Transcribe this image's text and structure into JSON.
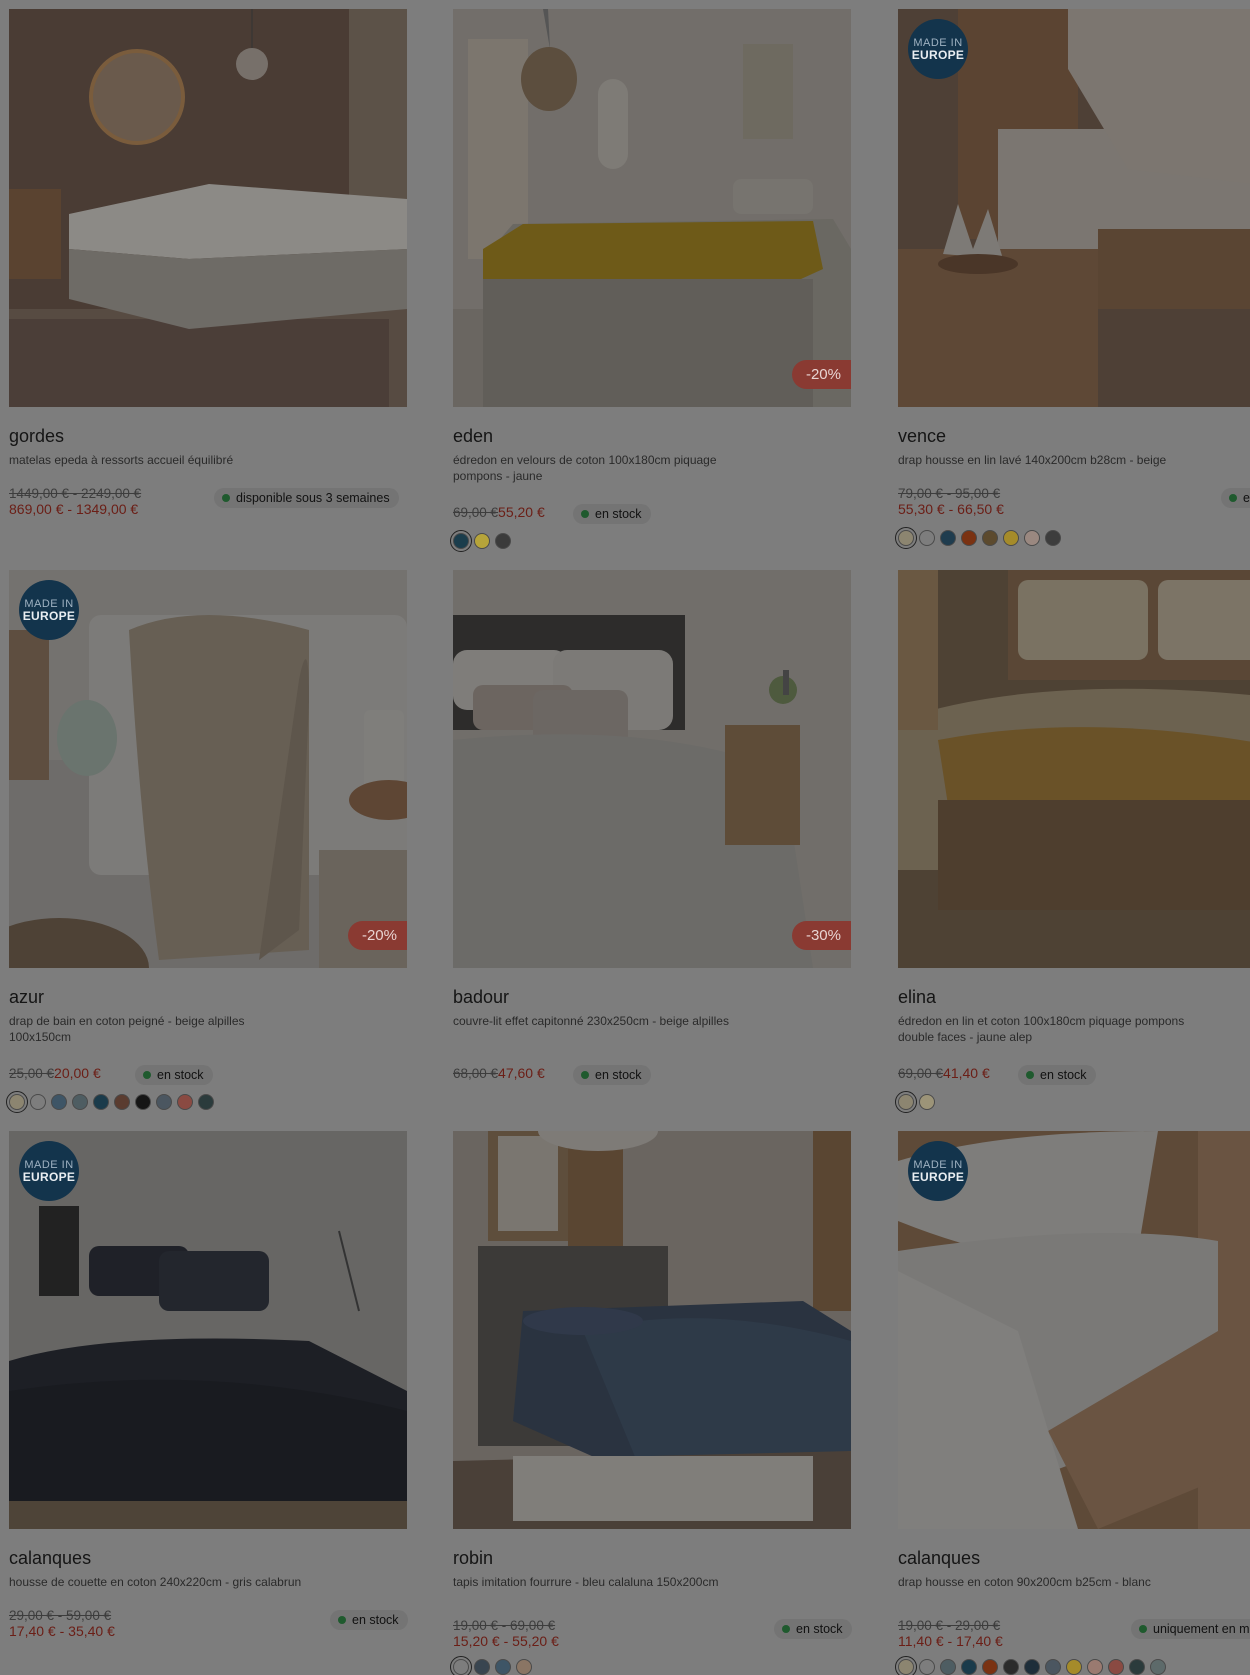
{
  "made_in_europe": {
    "line1": "MADE IN",
    "line2": "EUROPE"
  },
  "products": [
    {
      "name": "gordes",
      "desc": "matelas epeda à ressorts accueil équilibré",
      "old": "1449,00 € - 2249,00 €",
      "new": "869,00 € - 1349,00 €",
      "stock": "disponible sous 3 semaines",
      "discount": "",
      "eu": false,
      "swatches": []
    },
    {
      "name": "eden",
      "desc": "édredon en velours de coton 100x180cm piquage pompons - jaune",
      "old": "69,00 €",
      "new": "55,20 €",
      "stock": "en stock",
      "discount": "-20%",
      "eu": false,
      "swatches": [
        "#1b3d4c",
        "#b6a43a",
        "#3b3b3b"
      ]
    },
    {
      "name": "vence",
      "desc": "drap housse en lin lavé 140x200cm b28cm - beige",
      "old": "79,00 € - 95,00 €",
      "new": "55,30 € - 66,50 €",
      "stock": "en",
      "discount": "",
      "eu": true,
      "swatches": [
        "#8c8570",
        "#7d7d7d",
        "#1f3c4e",
        "#7a3212",
        "#5c4a2e",
        "#a58b2a",
        "#9a8880",
        "#3d3d3d"
      ]
    },
    {
      "name": "azur",
      "desc": "drap de bain en coton peigné - beige alpilles 100x150cm",
      "old": "25,00 €",
      "new": "20,00 €",
      "stock": "en stock",
      "discount": "-20%",
      "eu": true,
      "swatches": [
        "#8c8570",
        "#7d7d7d",
        "#3e5566",
        "#4e5d62",
        "#1a3b4b",
        "#5a3c30",
        "#161616",
        "#4b5660",
        "#8a4a42",
        "#2b3b3c"
      ]
    },
    {
      "name": "badour",
      "desc": "couvre-lit effet capitonné 230x250cm - beige alpilles",
      "old": "68,00 €",
      "new": "47,60 €",
      "stock": "en stock",
      "discount": "-30%",
      "eu": false,
      "swatches": []
    },
    {
      "name": "elina",
      "desc": "édredon en lin et coton 100x180cm piquage pompons double faces - jaune alep",
      "old": "69,00 €",
      "new": "41,40 €",
      "stock": "en stock",
      "discount": "",
      "eu": false,
      "swatches": [
        "#8c8570",
        "#9c9478"
      ]
    },
    {
      "name": "calanques",
      "desc": "housse de couette en coton 240x220cm - gris calabrun",
      "old": "29,00 € - 59,00 €",
      "new": "17,40 € - 35,40 €",
      "stock": "en stock",
      "discount": "",
      "eu": true,
      "swatches": []
    },
    {
      "name": "robin",
      "desc": "tapis imitation fourrure - bleu calaluna 150x200cm",
      "old": "19,00 € - 69,00 €",
      "new": "15,20 € - 55,20 €",
      "stock": "en stock",
      "discount": "",
      "eu": false,
      "swatches": [
        "#7d7d7d",
        "#394550",
        "#3e5566",
        "#8a7564"
      ]
    },
    {
      "name": "calanques",
      "desc": "drap housse en coton 90x200cm b25cm - blanc",
      "old": "19,00 € - 29,00 €",
      "new": "11,40 € - 17,40 €",
      "stock": "uniquement en m",
      "discount": "",
      "eu": true,
      "swatches": [
        "#8c8570",
        "#7d7d7d",
        "#4e5d62",
        "#1a3b4b",
        "#7a3212",
        "#2b2b2b",
        "#1e2e3a",
        "#4b5660",
        "#a58b2a",
        "#9a7a70",
        "#8a4a42",
        "#2b3b3c",
        "#5d6a6a"
      ]
    }
  ]
}
